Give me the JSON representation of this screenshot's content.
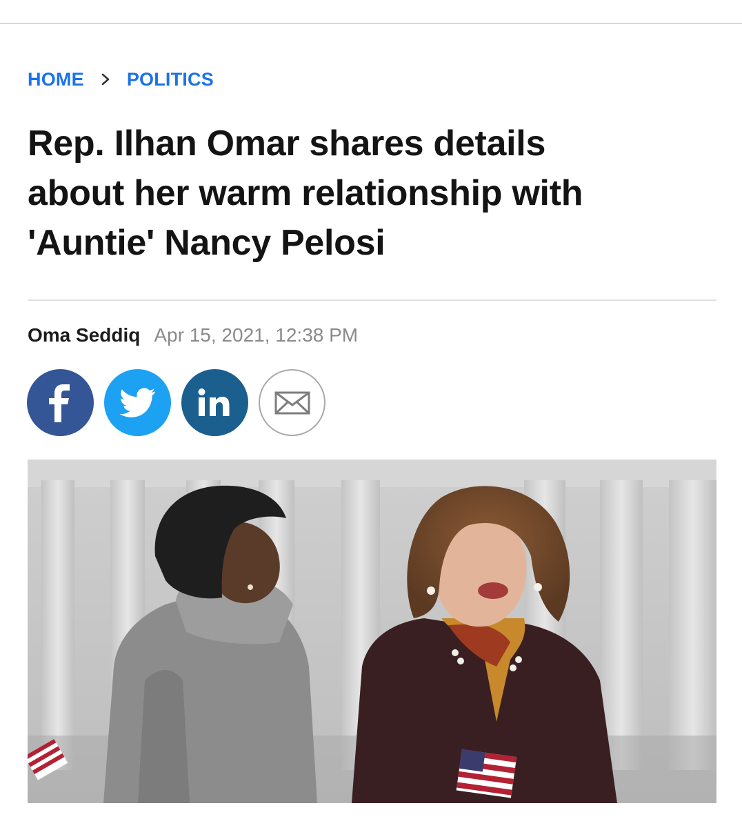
{
  "breadcrumb": {
    "home_label": "HOME",
    "separator_icon": "chevron-right-icon",
    "section_label": "POLITICS"
  },
  "article": {
    "headline_lines": [
      "Rep. Ilhan Omar shares details",
      "about her warm relationship with",
      "'Auntie' Nancy Pelosi"
    ],
    "author": "Oma Seddiq",
    "timestamp": "Apr 15, 2021, 12:38 PM"
  },
  "share": {
    "buttons": [
      {
        "icon": "facebook-icon",
        "color": "#345596"
      },
      {
        "icon": "twitter-icon",
        "color": "#1da1f2"
      },
      {
        "icon": "linkedin-icon",
        "color": "#1b5f8f"
      },
      {
        "icon": "email-icon",
        "color": "#ffffff"
      }
    ]
  },
  "hero_image": {
    "subject": "photo-two-women-outdoors-capitol-flags"
  },
  "colors": {
    "link": "#1a73e8",
    "headline": "#141414",
    "meta": "#8a8a8a"
  }
}
